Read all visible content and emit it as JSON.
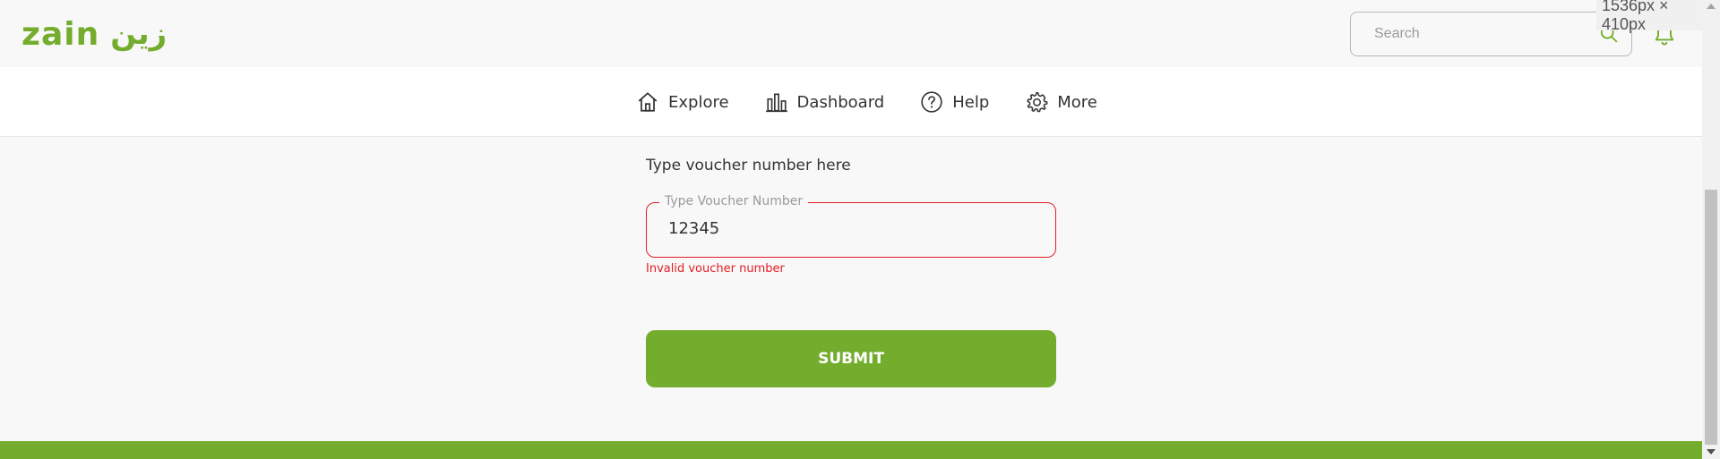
{
  "header": {
    "logo_text": "zain",
    "logo_arabic": "زين",
    "search": {
      "placeholder": "Search",
      "value": ""
    },
    "size_badge": "1536px × 410px",
    "size_badge_close": "×"
  },
  "nav": {
    "items": [
      {
        "label": "Explore",
        "icon": "home-icon"
      },
      {
        "label": "Dashboard",
        "icon": "bar-chart-icon"
      },
      {
        "label": "Help",
        "icon": "help-circle-icon"
      },
      {
        "label": "More",
        "icon": "gear-icon"
      }
    ]
  },
  "voucher": {
    "heading": "Type voucher number here",
    "field_label": "Type Voucher Number",
    "field_value": "12345",
    "error": "Invalid voucher number",
    "submit_label": "SUBMIT"
  },
  "colors": {
    "brand_green": "#74ad2e",
    "error_red": "#e31e24"
  }
}
